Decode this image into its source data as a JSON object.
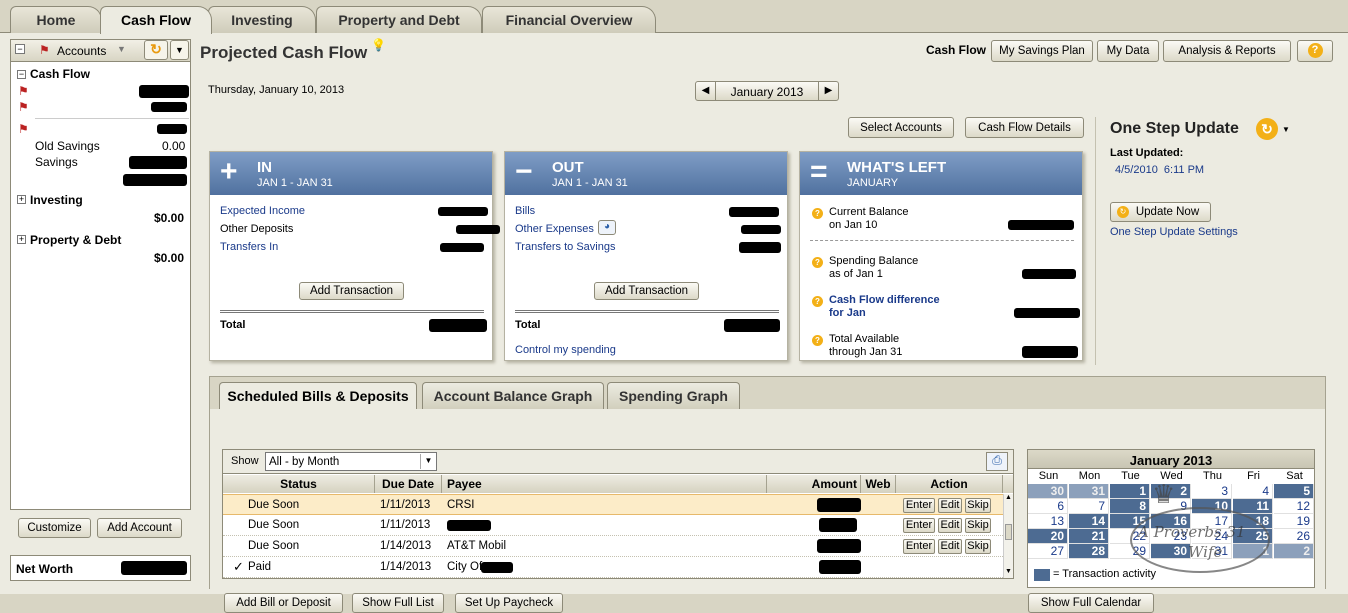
{
  "tabs": [
    "Home",
    "Cash Flow",
    "Investing",
    "Property and Debt",
    "Financial Overview"
  ],
  "left": {
    "accounts_label": "Accounts",
    "cash_flow": "Cash Flow",
    "old_savings": "Old Savings",
    "old_savings_val": "0.00",
    "savings": "Savings",
    "investing": "Investing",
    "investing_val": "$0.00",
    "property": "Property & Debt",
    "property_val": "$0.00",
    "customize": "Customize",
    "add_account": "Add Account",
    "net_worth": "Net Worth"
  },
  "header": {
    "title": "Projected Cash Flow",
    "date": "Thursday, January 10, 2013",
    "month": "January 2013",
    "nav": [
      "Cash Flow",
      "My Savings Plan",
      "My Data",
      "Analysis & Reports",
      "?"
    ],
    "select_accounts": "Select Accounts",
    "cash_flow_details": "Cash Flow Details"
  },
  "in_card": {
    "sym": "+",
    "title": "IN",
    "sub": "JAN 1 - JAN 31",
    "l1": "Expected Income",
    "l2": "Other Deposits",
    "l3": "Transfers In",
    "add": "Add Transaction",
    "total": "Total"
  },
  "out_card": {
    "sym": "−",
    "title": "OUT",
    "sub": "JAN 1 - JAN 31",
    "l1": "Bills",
    "l2": "Other Expenses",
    "l3": "Transfers to Savings",
    "add": "Add Transaction",
    "total": "Total",
    "control": "Control my spending"
  },
  "left_card": {
    "sym": "=",
    "title": "WHAT'S LEFT",
    "sub": "JANUARY",
    "l1a": "Current Balance",
    "l1b": "on Jan 10",
    "l2a": "Spending Balance",
    "l2b": "as of Jan 1",
    "l3a": "Cash Flow difference",
    "l3b": "for Jan",
    "l4a": "Total Available",
    "l4b": "through Jan 31"
  },
  "osu": {
    "title": "One Step Update",
    "last": "Last Updated:",
    "date": "4/5/2010  6:11 PM",
    "update_now": "Update Now",
    "settings": "One Step Update Settings"
  },
  "sched": {
    "tabs": [
      "Scheduled Bills & Deposits",
      "Account Balance Graph",
      "Spending Graph"
    ],
    "show_label": "Show",
    "show_value": "All - by Month",
    "cols": [
      "Status",
      "Due Date",
      "Payee",
      "Amount",
      "Web",
      "Action"
    ],
    "rows": [
      {
        "status": "Due Soon",
        "date": "1/11/2013",
        "payee": "CRSI",
        "check": ""
      },
      {
        "status": "Due Soon",
        "date": "1/11/2013",
        "payee": "",
        "check": ""
      },
      {
        "status": "Due Soon",
        "date": "1/14/2013",
        "payee": "AT&T Mobil",
        "check": ""
      },
      {
        "status": "Paid",
        "date": "1/14/2013",
        "payee": "City Of",
        "check": "✓"
      }
    ],
    "enter": "Enter",
    "edit": "Edit",
    "skip": "Skip",
    "add_bill": "Add Bill or Deposit",
    "show_full": "Show Full List",
    "paycheck": "Set Up Paycheck"
  },
  "calendar": {
    "title": "January 2013",
    "days": [
      "Sun",
      "Mon",
      "Tue",
      "Wed",
      "Thu",
      "Fri",
      "Sat"
    ],
    "legend": "= Transaction activity",
    "show_full": "Show Full Calendar",
    "cells": [
      [
        "30",
        "31",
        "1",
        "2",
        "3",
        "4",
        "5"
      ],
      [
        "6",
        "7",
        "8",
        "9",
        "10",
        "11",
        "12"
      ],
      [
        "13",
        "14",
        "15",
        "16",
        "17",
        "18",
        "19"
      ],
      [
        "20",
        "21",
        "22",
        "23",
        "24",
        "25",
        "26"
      ],
      [
        "27",
        "28",
        "29",
        "30",
        "31",
        "1",
        "2"
      ]
    ]
  },
  "watermark": {
    "line1": "A Proverbs 31",
    "line2": "Wife"
  }
}
